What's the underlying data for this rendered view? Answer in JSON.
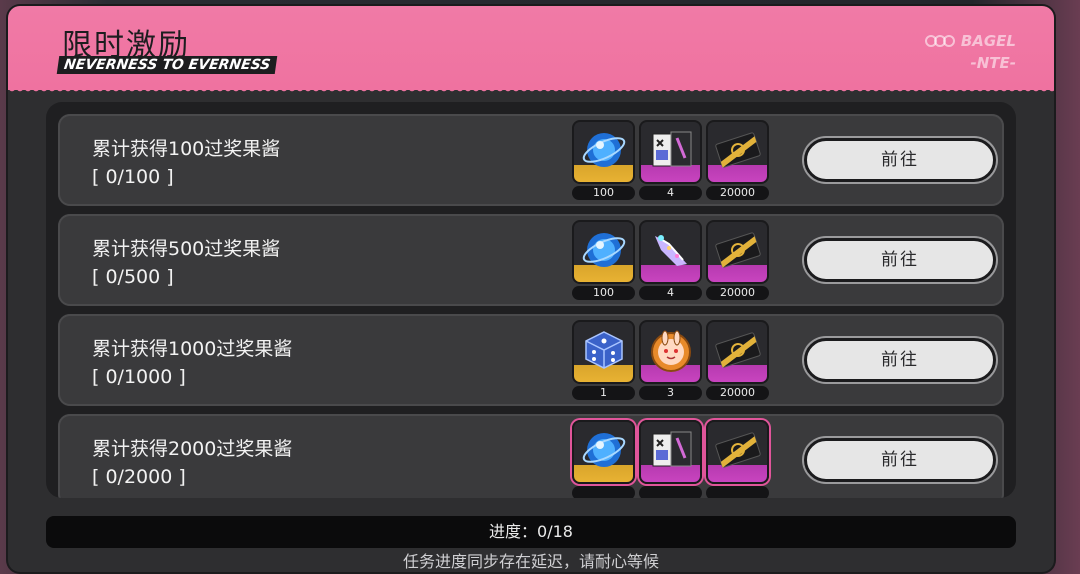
{
  "header": {
    "title": "限时激励",
    "subtitle": "NEVERNESS TO EVERNESS",
    "brand_line1": "BAGEL",
    "brand_line2": "-NTE-"
  },
  "rows": [
    {
      "title": "累计获得100过奖果酱",
      "progress": "[ 0/100 ]",
      "button": "前往",
      "items": [
        {
          "icon": "blue-orb-icon",
          "rarity": "gold",
          "count": "100"
        },
        {
          "icon": "card-pack-icon",
          "rarity": "purple",
          "count": "4"
        },
        {
          "icon": "gold-ticket-icon",
          "rarity": "purple",
          "count": "20000"
        }
      ]
    },
    {
      "title": "累计获得500过奖果酱",
      "progress": "[ 0/500 ]",
      "button": "前往",
      "items": [
        {
          "icon": "blue-orb-icon",
          "rarity": "gold",
          "count": "100"
        },
        {
          "icon": "crystal-shard-icon",
          "rarity": "purple",
          "count": "4"
        },
        {
          "icon": "gold-ticket-icon",
          "rarity": "purple",
          "count": "20000"
        }
      ]
    },
    {
      "title": "累计获得1000过奖果酱",
      "progress": "[ 0/1000 ]",
      "button": "前往",
      "items": [
        {
          "icon": "dice-icon",
          "rarity": "gold",
          "count": "1"
        },
        {
          "icon": "bunny-badge-icon",
          "rarity": "purple",
          "count": "3"
        },
        {
          "icon": "gold-ticket-icon",
          "rarity": "purple",
          "count": "20000"
        }
      ]
    },
    {
      "title": "累计获得2000过奖果酱",
      "progress": "[ 0/2000 ]",
      "button": "前往",
      "items": [
        {
          "icon": "blue-orb-icon",
          "rarity": "gold",
          "count": ""
        },
        {
          "icon": "card-pack-icon",
          "rarity": "purple",
          "count": ""
        },
        {
          "icon": "gold-ticket-icon",
          "rarity": "purple",
          "count": ""
        }
      ]
    }
  ],
  "footer": {
    "progress": "进度：0/18",
    "note": "任务进度同步存在延迟，请耐心等候"
  },
  "colors": {
    "header_pink": "#ef72a0",
    "gold": "#e8b233",
    "purple": "#c844bf"
  }
}
